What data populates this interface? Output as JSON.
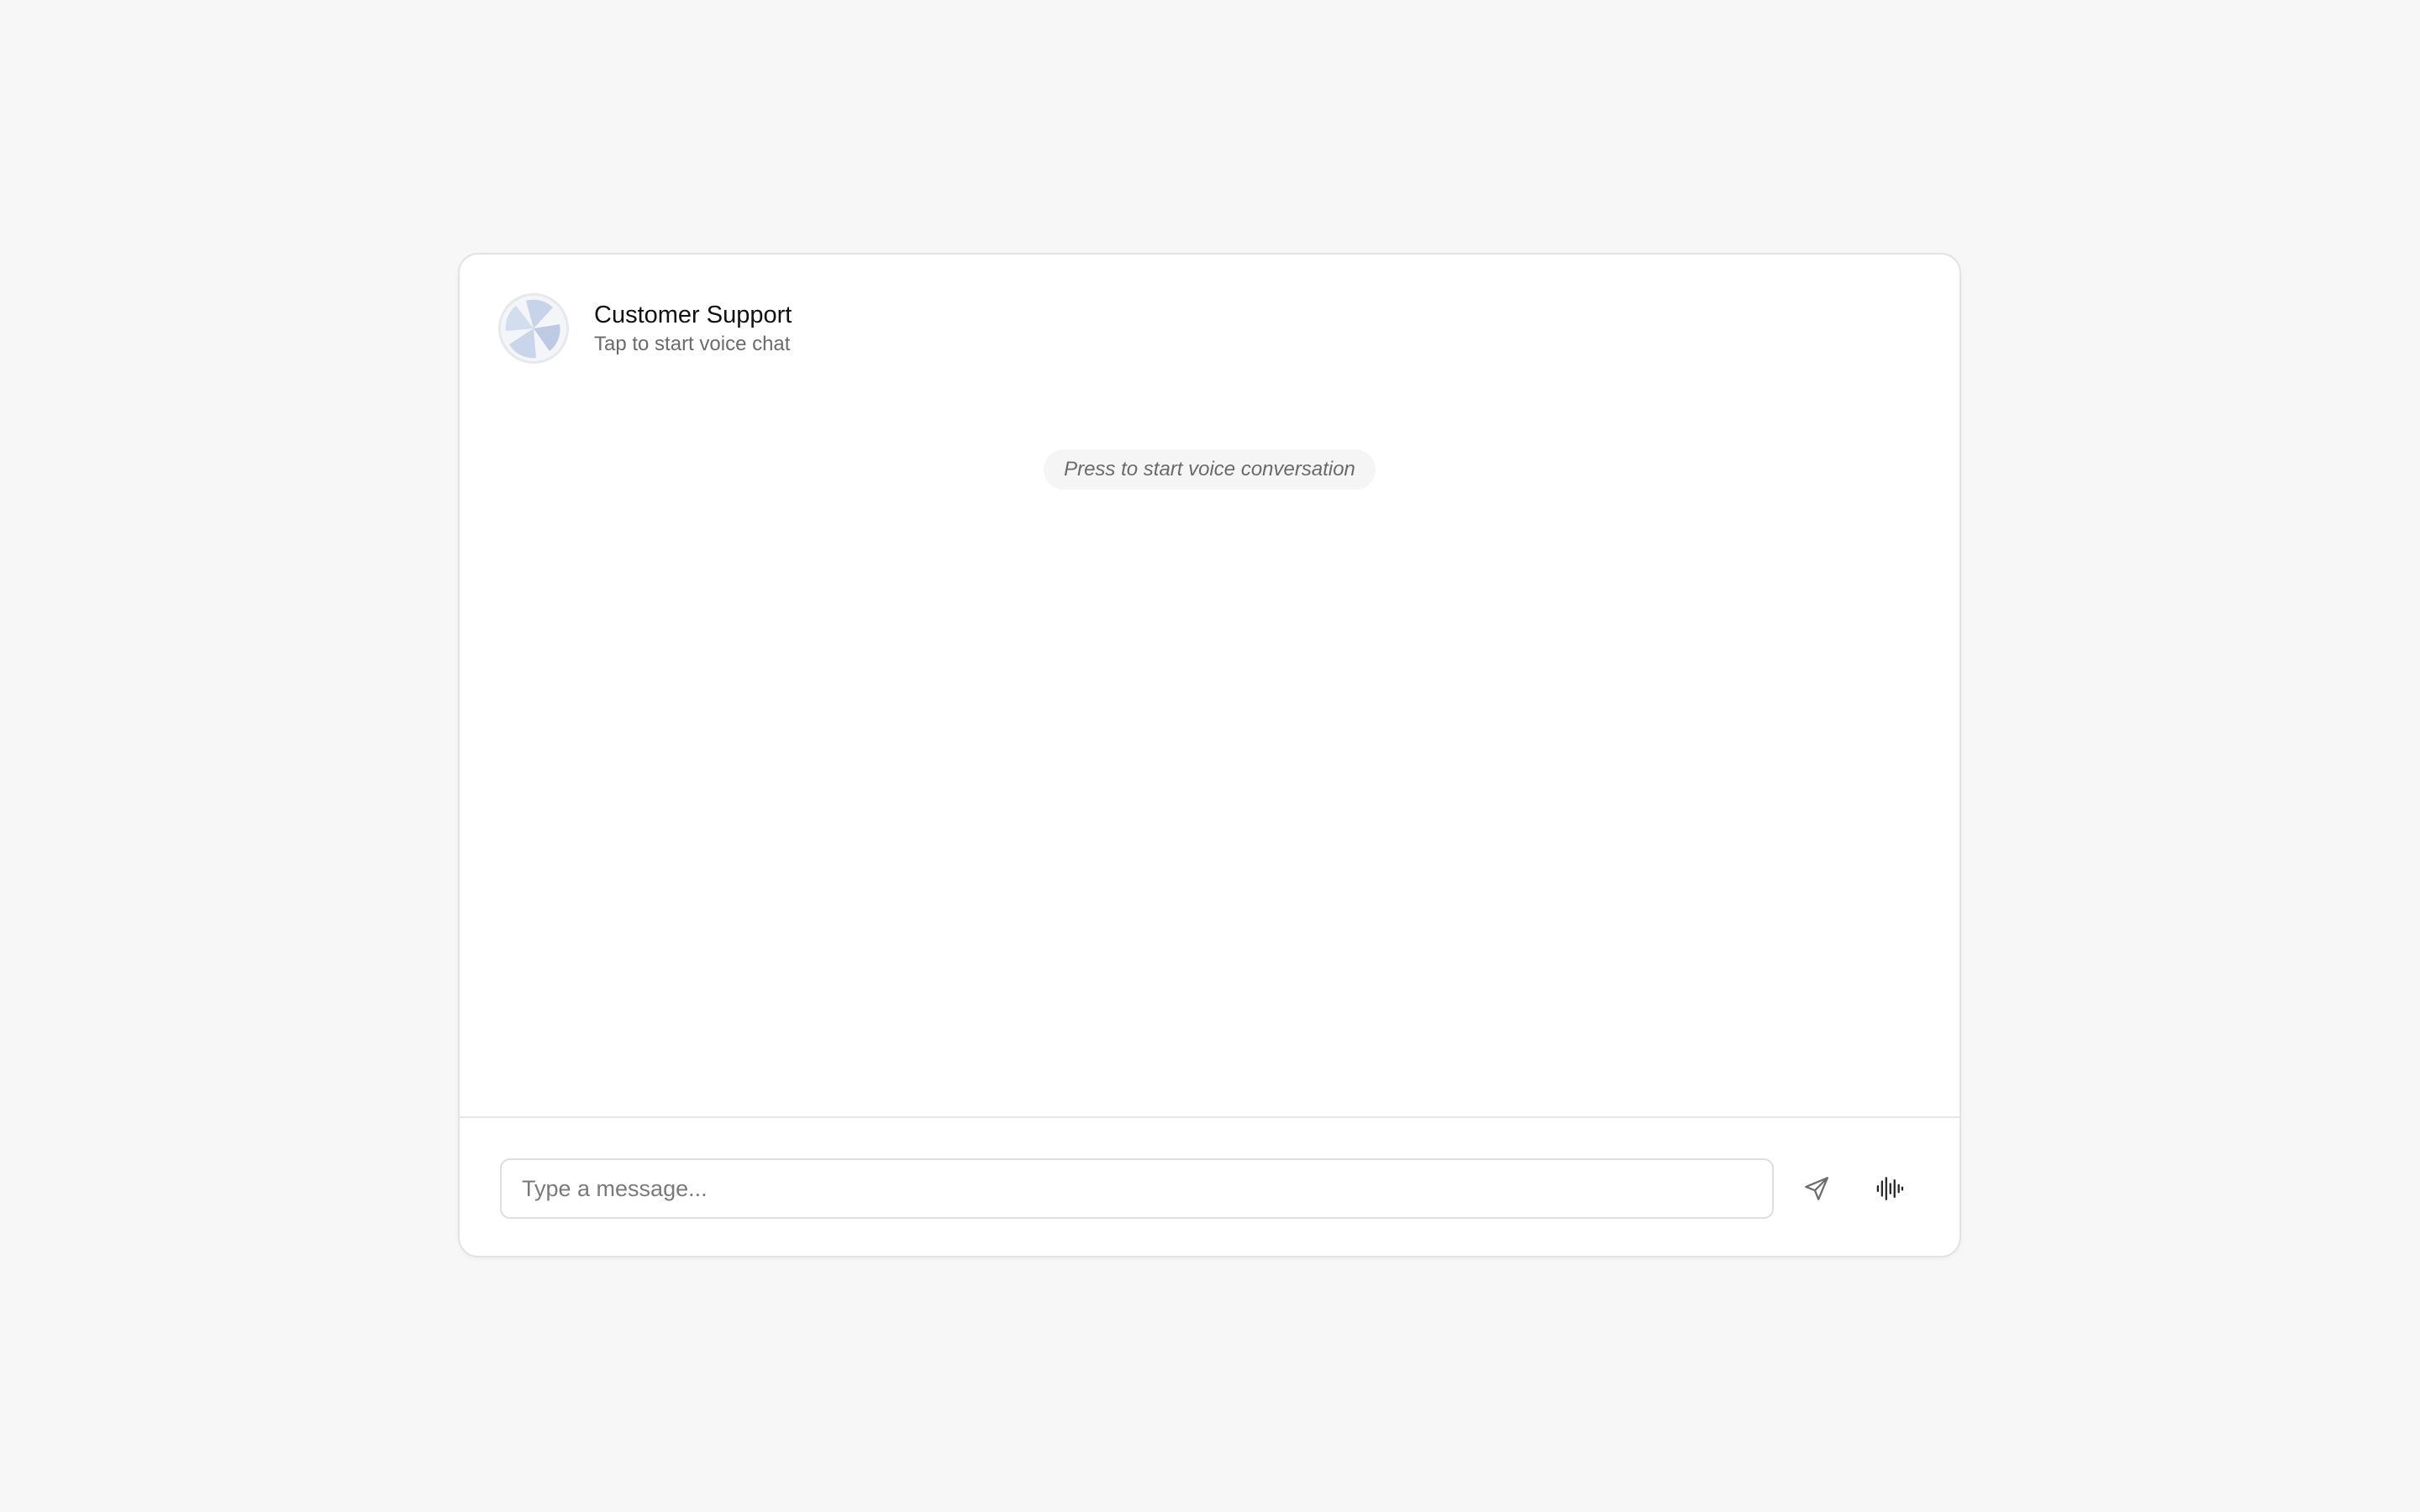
{
  "header": {
    "title": "Customer Support",
    "subtitle": "Tap to start voice chat",
    "avatar_icon": "pinwheel-avatar-icon"
  },
  "conversation": {
    "hint": "Press to start voice conversation"
  },
  "composer": {
    "placeholder": "Type a message...",
    "send_icon": "send-icon",
    "voice_icon": "waveform-icon"
  },
  "colors": {
    "background": "#f7f7f7",
    "card": "#ffffff",
    "avatar_tint": "#c9d6ea"
  }
}
